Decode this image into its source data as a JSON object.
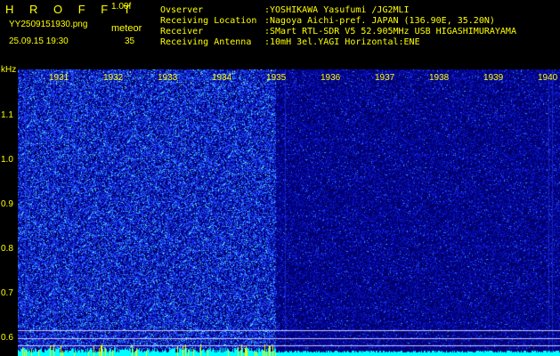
{
  "header": {
    "app_name": "H R O F F T",
    "version": "1.00f",
    "filename": "YY2509151930.png",
    "datetime": "25.09.15 19:30",
    "type_label": "meteor",
    "count": "35"
  },
  "info": {
    "observer_label": "Ovserver",
    "observer_value": ":YOSHIKAWA Yasufumi /JG2MLI",
    "location_label": "Receiving Location",
    "location_value": ":Nagoya Aichi-pref. JAPAN (136.90E, 35.20N)",
    "receiver_label": "Receiver",
    "receiver_value": ":SMart RTL-SDR V5 52.905MHz USB HIGASHIMURAYAMA",
    "antenna_label": "Receiving Antenna",
    "antenna_value": ":10mH 3el.YAGI Horizontal:ENE"
  },
  "axis": {
    "unit": "kHz",
    "y_ticks": [
      "1.1",
      "1.0",
      "0.9",
      "0.8",
      "0.7",
      "0.6"
    ],
    "x_ticks": [
      "1931",
      "1932",
      "1933",
      "1934",
      "1935",
      "1936",
      "1937",
      "1938",
      "1939",
      "1940"
    ]
  }
}
